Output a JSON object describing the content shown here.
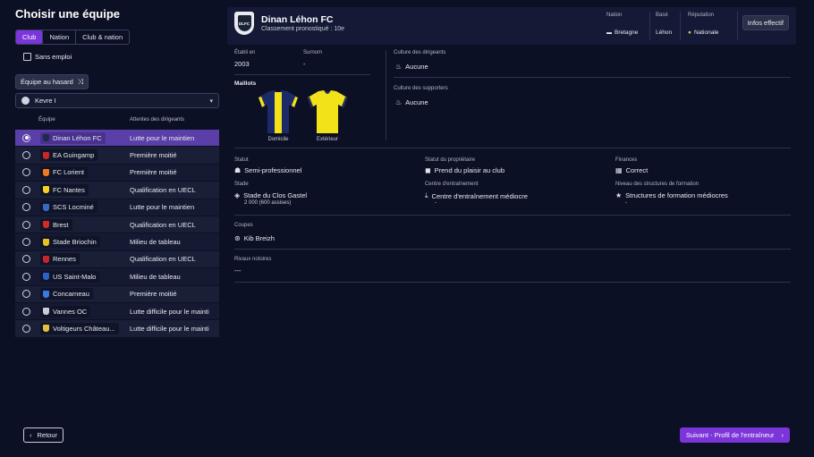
{
  "page_title": "Choisir une équipe",
  "tabs": [
    {
      "label": "Club",
      "active": true
    },
    {
      "label": "Nation",
      "active": false
    },
    {
      "label": "Club & nation",
      "active": false
    }
  ],
  "unemployed_label": "Sans emploi",
  "random_button_label": "Équipe au hasard",
  "league_select_value": "Kevre I",
  "table_headers": {
    "team": "Équipe",
    "expectation": "Attentes des dirigeants"
  },
  "teams": [
    {
      "name": "Dinan Léhon FC",
      "expectation": "Lutte pour le maintien",
      "selected": true,
      "crest_color": "#1e2a4a"
    },
    {
      "name": "EA Guingamp",
      "expectation": "Première moitié",
      "selected": false,
      "crest_color": "#c8262a"
    },
    {
      "name": "FC Lorient",
      "expectation": "Première moitié",
      "selected": false,
      "crest_color": "#f07a22"
    },
    {
      "name": "FC Nantes",
      "expectation": "Qualification en UECL",
      "selected": false,
      "crest_color": "#f5d21e"
    },
    {
      "name": "SCS Locminé",
      "expectation": "Lutte pour le maintien",
      "selected": false,
      "crest_color": "#3a6ac8"
    },
    {
      "name": "Brest",
      "expectation": "Qualification en UECL",
      "selected": false,
      "crest_color": "#d42a2a"
    },
    {
      "name": "Stade Briochin",
      "expectation": "Milieu de tableau",
      "selected": false,
      "crest_color": "#e6c21e"
    },
    {
      "name": "Rennes",
      "expectation": "Qualification en UECL",
      "selected": false,
      "crest_color": "#c8262a"
    },
    {
      "name": "US Saint-Malo",
      "expectation": "Milieu de tableau",
      "selected": false,
      "crest_color": "#2a62c8"
    },
    {
      "name": "Concarneau",
      "expectation": "Première moitié",
      "selected": false,
      "crest_color": "#3a7ae0"
    },
    {
      "name": "Vannes OC",
      "expectation": "Lutte difficile pour le mainti",
      "selected": false,
      "crest_color": "#c8ccd9"
    },
    {
      "name": "Voltigeurs Château...",
      "expectation": "Lutte difficile pour le mainti",
      "selected": false,
      "crest_color": "#e0c040"
    }
  ],
  "back_label": "Retour",
  "next_label": "Suivant - Profil de l'entraîneur",
  "club": {
    "name": "Dinan Léhon FC",
    "crest_text": "DLFC",
    "rank": "Classement pronostiqué : 10e",
    "nation_label": "Nation",
    "nation_value": "Bretagne",
    "based_label": "Basé",
    "based_value": "Léhon",
    "reputation_label": "Réputation",
    "reputation_value": "Nationale",
    "info_button": "Infos effectif",
    "founded_label": "Établi en",
    "founded_value": "2003",
    "nickname_label": "Surnom",
    "nickname_value": "-",
    "kits_label": "Maillots",
    "kit_home": "Domicile",
    "kit_away": "Extérieur",
    "board_culture_label": "Culture des dirigeants",
    "board_culture_value": "Aucune",
    "fans_culture_label": "Culture des supporters",
    "fans_culture_value": "Aucune",
    "status_label": "Statut",
    "status_value": "Semi-professionnel",
    "owner_label": "Statut du propriétaire",
    "owner_value": "Prend du plaisir au club",
    "finances_label": "Finances",
    "finances_value": "Correct",
    "stadium_label": "Stade",
    "stadium_value": "Stade du Clos Gastel",
    "stadium_capacity": "2 000 (600 assises)",
    "training_label": "Centre d'entraînement",
    "training_value": "Centre d'entraînement médiocre",
    "training_sub": "-",
    "youth_label": "Niveau des structures de formation",
    "youth_value": "Structures de formation médiocres",
    "youth_sub": "-",
    "cups_label": "Coupes",
    "cups_value": "Kib Breizh",
    "rivals_label": "Rivaux notoires",
    "rivals_value": "---"
  },
  "colors": {
    "accent": "#7b35d9",
    "kit_home_primary": "#f2e21a",
    "kit_home_secondary": "#1d2a6a",
    "kit_away": "#f2e21a"
  }
}
